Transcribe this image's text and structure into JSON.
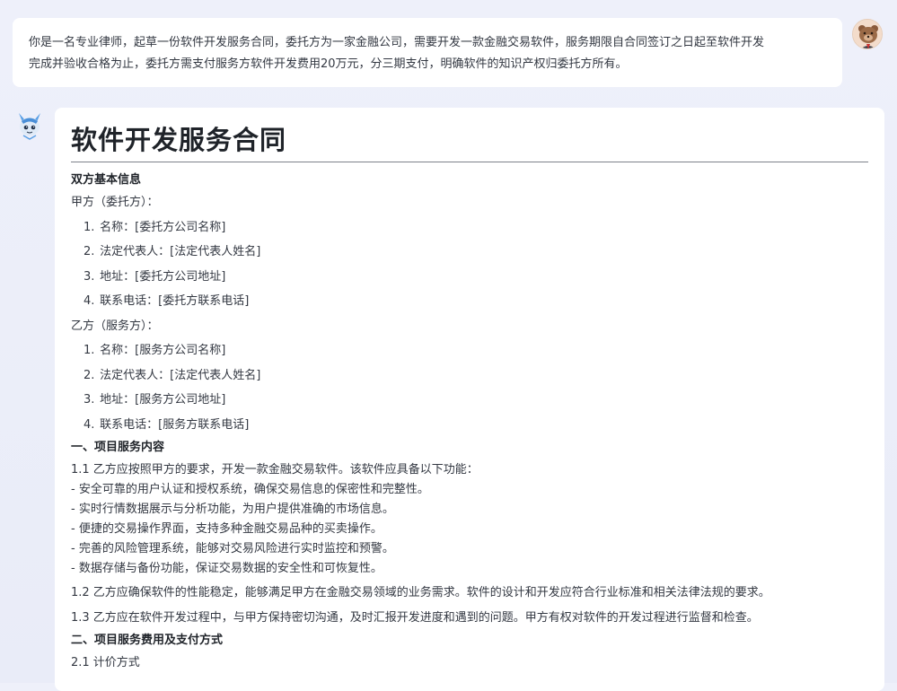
{
  "user_message": {
    "line1": "你是一名专业律师，起草一份软件开发服务合同，委托方为一家金融公司，需要开发一款金融交易软件，服务期限自合同签订之日起至软件开发",
    "line2": "完成并验收合格为止，委托方需支付服务方软件开发费用20万元，分三期支付，明确软件的知识产权归委托方所有。"
  },
  "assistant_answer": {
    "title": "软件开发服务合同",
    "section_basic": "双方基本信息",
    "party_a": "甲方（委托方）：",
    "party_a_items": [
      {
        "num": "1.",
        "text": "名称：[委托方公司名称]"
      },
      {
        "num": "2.",
        "text": "法定代表人：[法定代表人姓名]"
      },
      {
        "num": "3.",
        "text": "地址：[委托方公司地址]"
      },
      {
        "num": "4.",
        "text": "联系电话：[委托方联系电话]"
      }
    ],
    "party_b": "乙方（服务方）：",
    "party_b_items": [
      {
        "num": "1.",
        "text": "名称：[服务方公司名称]"
      },
      {
        "num": "2.",
        "text": "法定代表人：[法定代表人姓名]"
      },
      {
        "num": "3.",
        "text": "地址：[服务方公司地址]"
      },
      {
        "num": "4.",
        "text": "联系电话：[服务方联系电话]"
      }
    ],
    "section_1": "一、项目服务内容",
    "p1_1": "1.1 乙方应按照甲方的要求，开发一款金融交易软件。该软件应具备以下功能：",
    "bullets": [
      "- 安全可靠的用户认证和授权系统，确保交易信息的保密性和完整性。",
      "- 实时行情数据展示与分析功能，为用户提供准确的市场信息。",
      "- 便捷的交易操作界面，支持多种金融交易品种的买卖操作。",
      "- 完善的风险管理系统，能够对交易风险进行实时监控和预警。",
      "- 数据存储与备份功能，保证交易数据的安全性和可恢复性。"
    ],
    "p1_2": "1.2 乙方应确保软件的性能稳定，能够满足甲方在金融交易领域的业务需求。软件的设计和开发应符合行业标准和相关法律法规的要求。",
    "p1_3": "1.3 乙方应在软件开发过程中，与甲方保持密切沟通，及时汇报开发进度和遇到的问题。甲方有权对软件的开发过程进行监督和检查。",
    "section_2": "二、项目服务费用及支付方式",
    "p2_1": "2.1 计价方式"
  },
  "colors": {
    "background": "#eceffa",
    "card": "#ffffff",
    "text": "#333842",
    "heading": "#1f2329"
  }
}
